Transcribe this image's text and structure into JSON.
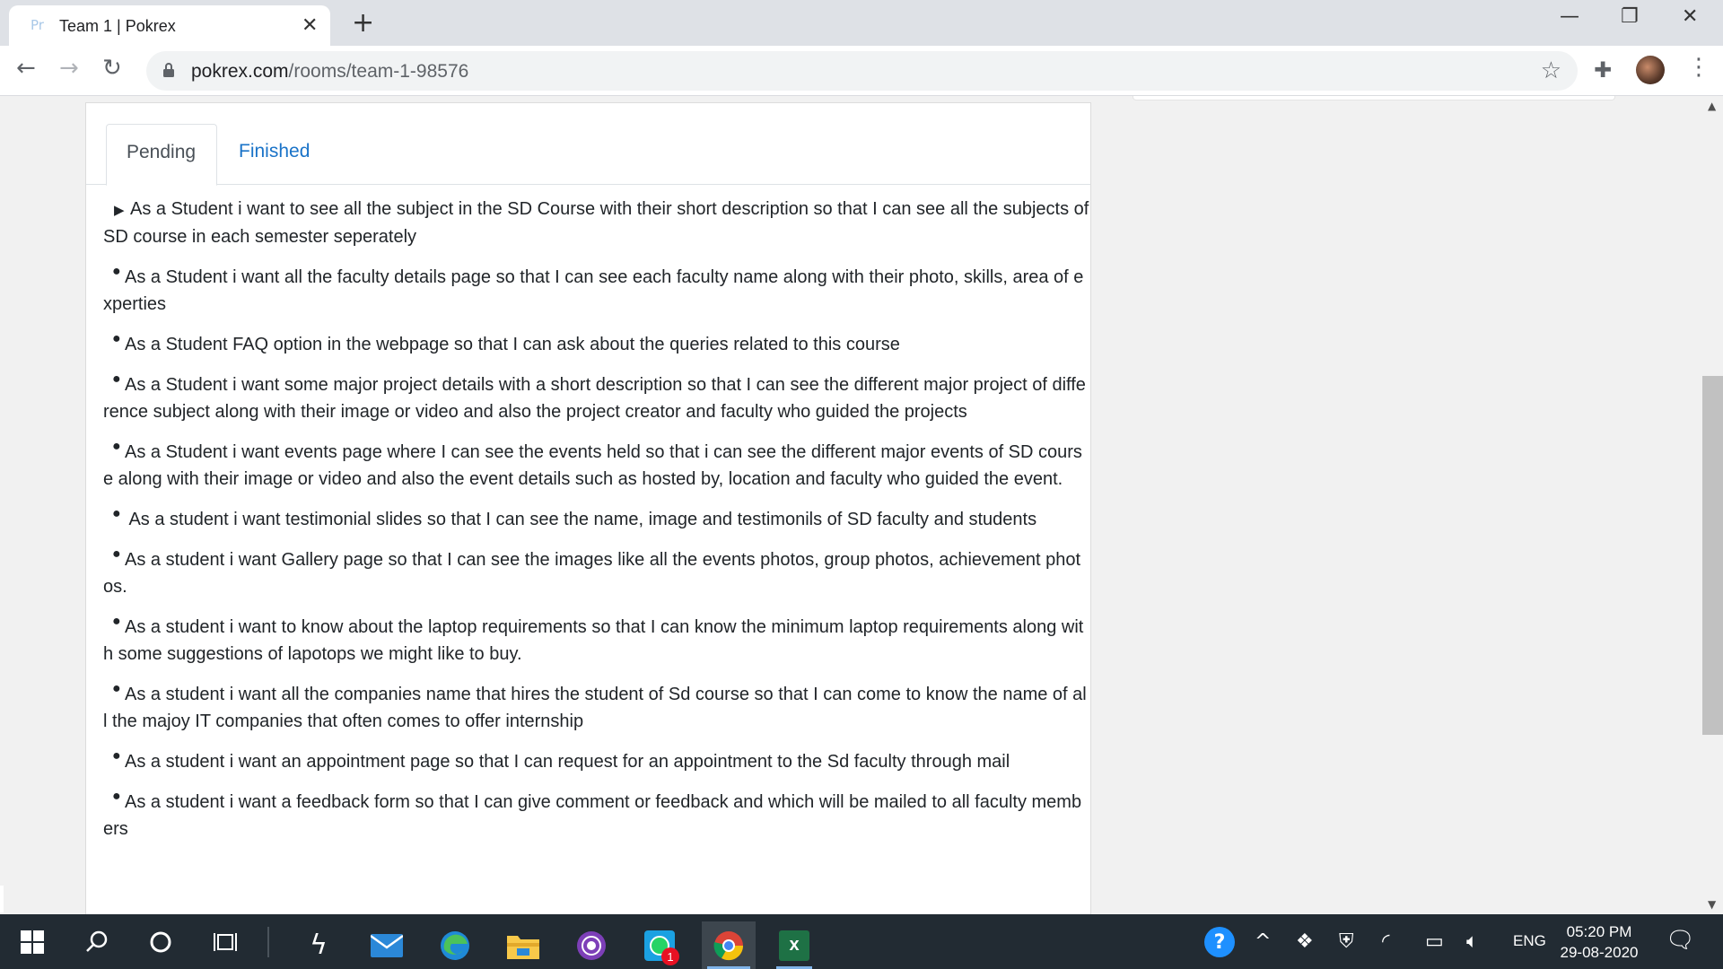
{
  "browser": {
    "tab_title": "Team 1 | Pokrex",
    "tab_favicon": "Pr",
    "url_host": "pokrex.com",
    "url_path": "/rooms/team-1-98576"
  },
  "tabs": {
    "pending": "Pending",
    "finished": "Finished"
  },
  "stories": [
    {
      "marker": "triangle",
      "text": "As a Student i want to see all the subject in the SD Course with their short description so that I can see all the subjects of SD course in each semester seperately"
    },
    {
      "marker": "bullet",
      "text": "As a Student i want all the faculty details page so that I can see each faculty name along with their photo, skills, area of experties"
    },
    {
      "marker": "bullet",
      "text": "As a Student FAQ option in the webpage so that I can ask about the queries related to this course"
    },
    {
      "marker": "bullet",
      "text": "As a Student i want some major project details with a short description so that I can see the different major project of difference subject along with their image or video and also the project creator and faculty who guided the projects"
    },
    {
      "marker": "bullet",
      "text": "As a Student i want events page where I can see the events held so that i can see the different major events of SD course along with their image or video and also the event details such as hosted by, location and faculty who guided the event."
    },
    {
      "marker": "bullet",
      "text": " As a student i want testimonial slides so that I can see the name, image and testimonils of SD faculty and students"
    },
    {
      "marker": "bullet",
      "text": "As a student i want Gallery page so that I can see the images like all the events photos, group photos, achievement photos."
    },
    {
      "marker": "bullet",
      "text": "As a student i want to know about the laptop requirements so that I can know the minimum laptop requirements along with some suggestions of lapotops we might like to buy."
    },
    {
      "marker": "bullet",
      "text": "As a student i want all the companies name that hires the student of Sd course so that I can come to know the name of all the majoy IT companies that often comes to offer internship"
    },
    {
      "marker": "bullet",
      "text": "As a student i want an appointment page so that I can request for an appointment to the Sd faculty through mail"
    },
    {
      "marker": "bullet",
      "text": "As a student i want a feedback form so that I can give comment or feedback and which will be mailed to all faculty members"
    }
  ],
  "taskbar": {
    "language": "ENG",
    "time": "05:20 PM",
    "date": "29-08-2020",
    "whatsapp_badge": "1"
  }
}
